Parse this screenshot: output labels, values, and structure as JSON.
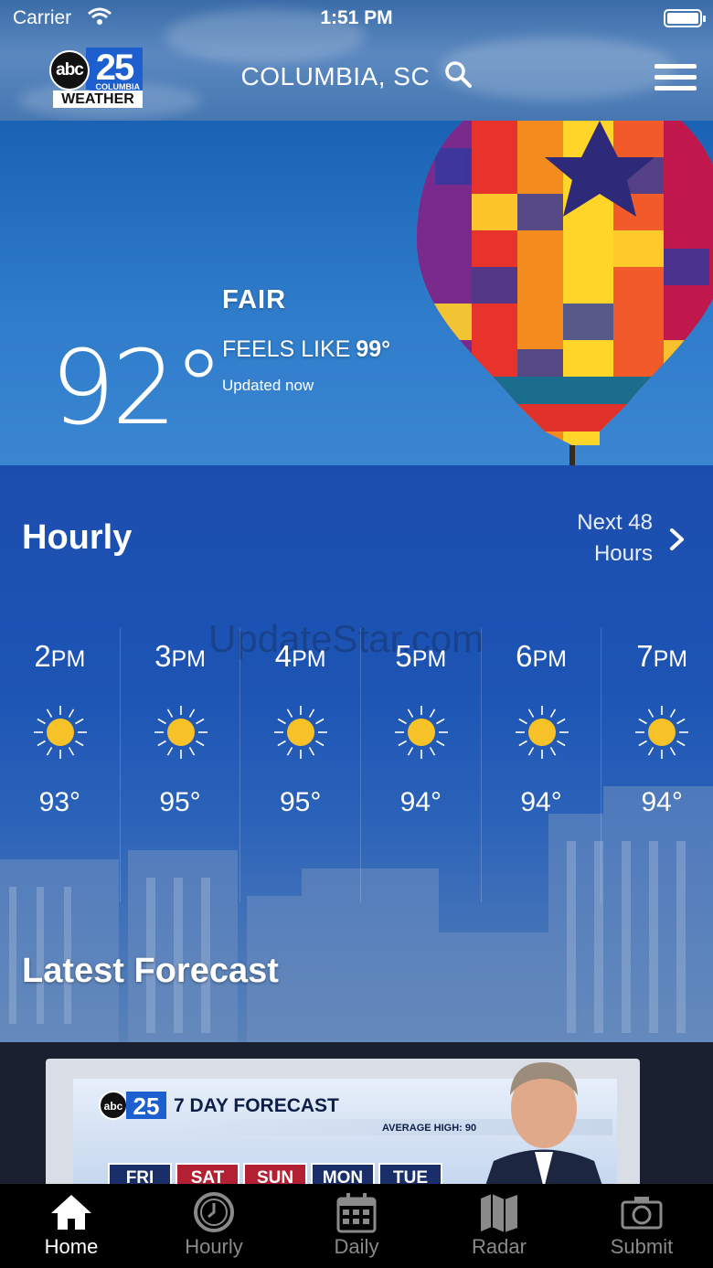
{
  "status_bar": {
    "carrier": "Carrier",
    "time": "1:51 PM"
  },
  "header": {
    "logo": {
      "network": "abc",
      "channel": "25",
      "city": "COLUMBIA",
      "brand": "WEATHER"
    },
    "location": "COLUMBIA, SC"
  },
  "current": {
    "condition": "FAIR",
    "feels_like_label": "FEELS LIKE",
    "feels_like_value": "99°",
    "updated": "Updated now",
    "temperature": "92°"
  },
  "hourly": {
    "title": "Hourly",
    "link_line1": "Next 48",
    "link_line2": "Hours",
    "watermark": "UpdateStar.com",
    "hours": [
      {
        "time": "2",
        "suffix": "PM",
        "temp": "93°",
        "icon": "sun-icon"
      },
      {
        "time": "3",
        "suffix": "PM",
        "temp": "95°",
        "icon": "sun-icon"
      },
      {
        "time": "4",
        "suffix": "PM",
        "temp": "95°",
        "icon": "sun-icon"
      },
      {
        "time": "5",
        "suffix": "PM",
        "temp": "94°",
        "icon": "sun-icon"
      },
      {
        "time": "6",
        "suffix": "PM",
        "temp": "94°",
        "icon": "sun-icon"
      },
      {
        "time": "7",
        "suffix": "PM",
        "temp": "94°",
        "icon": "sun-icon"
      }
    ]
  },
  "latest": {
    "title": "Latest Forecast",
    "video": {
      "headline": "7 DAY FORECAST",
      "average": "AVERAGE HIGH: 90",
      "days": [
        "FRI",
        "SAT",
        "SUN",
        "MON",
        "TUE"
      ]
    }
  },
  "tabbar": {
    "items": [
      {
        "label": "Home",
        "icon": "home-icon",
        "active": true
      },
      {
        "label": "Hourly",
        "icon": "clock-icon",
        "active": false
      },
      {
        "label": "Daily",
        "icon": "calendar-icon",
        "active": false
      },
      {
        "label": "Radar",
        "icon": "map-icon",
        "active": false
      },
      {
        "label": "Submit",
        "icon": "camera-icon",
        "active": false
      }
    ]
  },
  "colors": {
    "accent_blue": "#1e5fd0",
    "sun": "#f7c228",
    "tab_active": "#ffffff",
    "tab_inactive": "#8a8a8a"
  }
}
